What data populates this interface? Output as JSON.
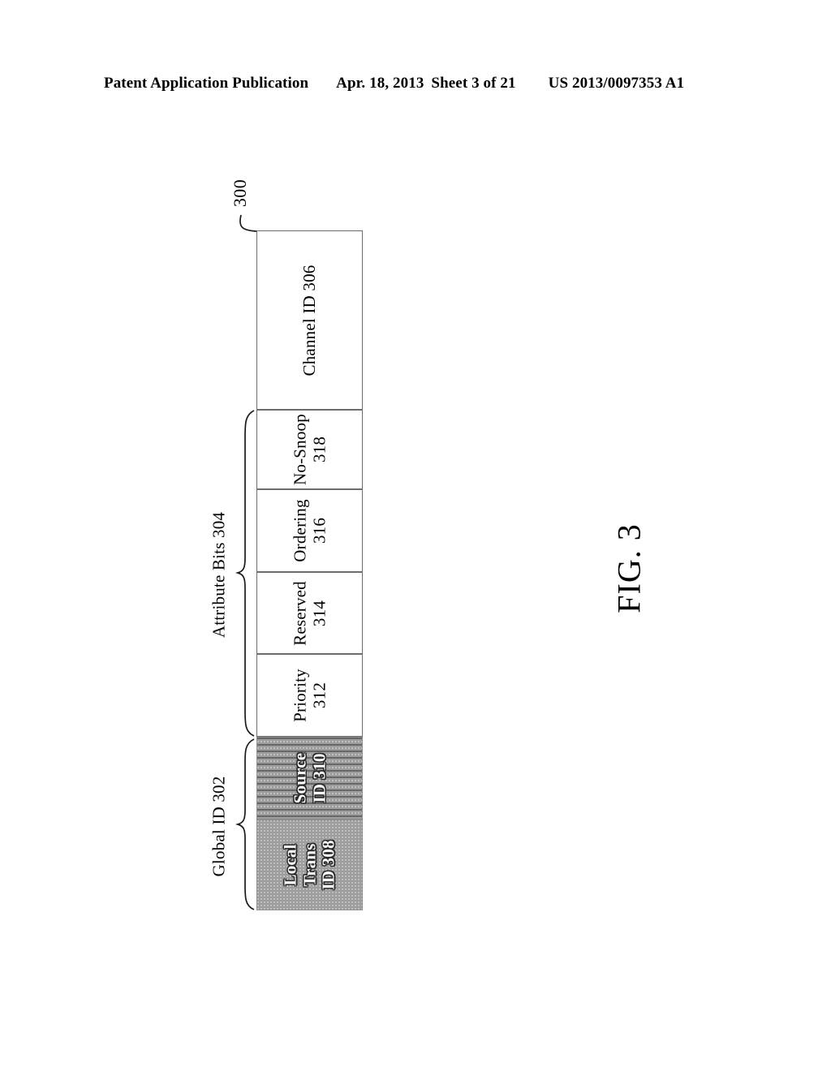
{
  "header": {
    "publication": "Patent Application Publication",
    "date": "Apr. 18, 2013",
    "sheet": "Sheet 3 of 21",
    "publication_number": "US 2013/0097353 A1"
  },
  "figure": {
    "caption": "FIG. 3",
    "reference_numeral": "300",
    "fields": [
      {
        "id": "channel-id",
        "label": "Channel ID 306",
        "numeral": "306",
        "shaded": false,
        "hatch": "none"
      },
      {
        "id": "no-snoop",
        "label": "No-Snoop\n318",
        "line1": "No-Snoop",
        "line2": "318",
        "numeral": "318",
        "shaded": false,
        "hatch": "none"
      },
      {
        "id": "ordering",
        "label": "Ordering\n316",
        "line1": "Ordering",
        "line2": "316",
        "numeral": "316",
        "shaded": false,
        "hatch": "none"
      },
      {
        "id": "reserved",
        "label": "Reserved\n314",
        "line1": "Reserved",
        "line2": "314",
        "numeral": "314",
        "shaded": false,
        "hatch": "none"
      },
      {
        "id": "priority",
        "label": "Priority\n312",
        "line1": "Priority",
        "line2": "312",
        "numeral": "312",
        "shaded": false,
        "hatch": "none"
      },
      {
        "id": "source-id",
        "label": "Source\nID 310",
        "line1": "Source",
        "line2": "ID 310",
        "numeral": "310",
        "shaded": true,
        "hatch": "horizontal-lines"
      },
      {
        "id": "local-trans-id",
        "label": "Local\nTrans\nID 308",
        "line1": "Local",
        "line2": "Trans",
        "line3": "ID 308",
        "numeral": "308",
        "shaded": true,
        "hatch": "stipple"
      }
    ],
    "groups": [
      {
        "id": "attribute-bits",
        "label": "Attribute Bits 304",
        "numeral": "304",
        "covers": [
          "no-snoop",
          "ordering",
          "reserved",
          "priority"
        ]
      },
      {
        "id": "global-id",
        "label": "Global ID 302",
        "numeral": "302",
        "covers": [
          "source-id",
          "local-trans-id"
        ]
      }
    ]
  },
  "colors": {
    "ink": "#000000",
    "box_border": "#6d6d6d",
    "shade_fill": "#9d9d9d",
    "hatch_line": "#5a5a5a",
    "paper": "#ffffff"
  }
}
